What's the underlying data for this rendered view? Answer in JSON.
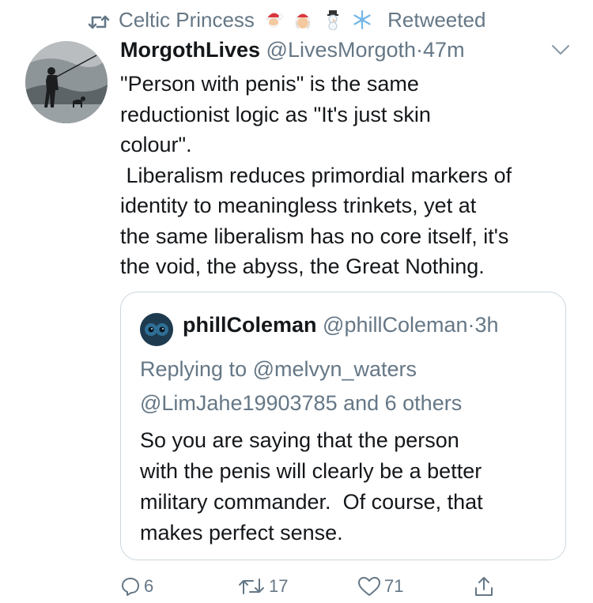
{
  "retweet_header": {
    "retweeter_name": "Celtic Princess",
    "emojis": [
      "santa-icon",
      "mrs-claus-icon",
      "snowman-icon",
      "snowflake-icon"
    ],
    "label": "Retweeted"
  },
  "tweet": {
    "display_name": "MorgothLives",
    "handle": "@LivesMorgoth",
    "separator": "·",
    "time": "47m",
    "text": "\"Person with penis\" is the same\nreductionist logic as \"It's just skin\ncolour\".\n Liberalism reduces primordial markers of\nidentity to meaningless trinkets, yet at\nthe same liberalism has no core itself, it's\nthe void, the abyss, the Great Nothing."
  },
  "quote": {
    "display_name": "phillColeman",
    "handle": "@phillColeman",
    "separator": "·",
    "time": "3h",
    "replying_to": "Replying to @melvyn_waters\n@LimJahe19903785 and 6 others",
    "text": "So you are saying that the person\nwith the penis will clearly be a better\nmilitary commander.  Of course, that\nmakes perfect sense."
  },
  "actions": {
    "replies": "6",
    "retweets": "17",
    "likes": "71"
  },
  "colors": {
    "text": "#14171a",
    "secondary": "#657786",
    "border": "#ccd6dd"
  }
}
